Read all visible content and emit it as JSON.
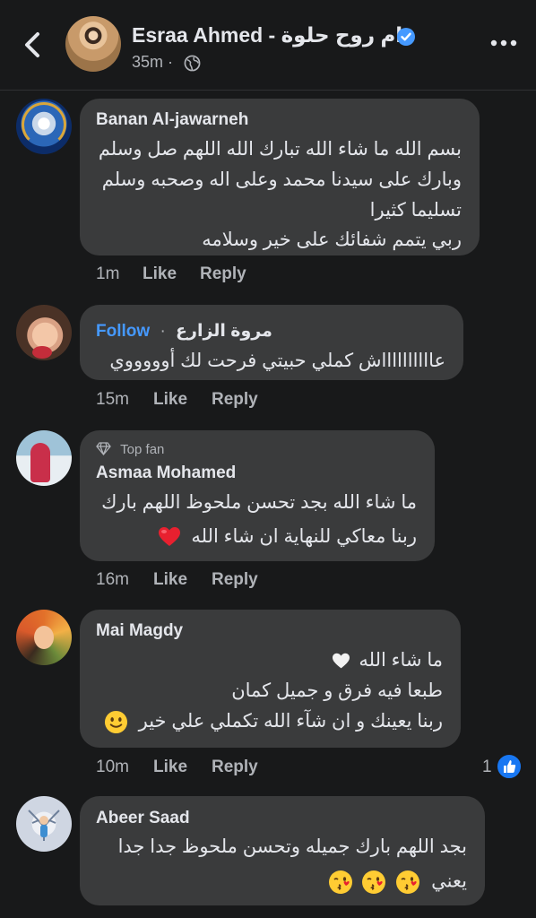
{
  "header": {
    "author": "Esraa Ahmed - ام روح حلوة",
    "time": "35m",
    "dot": "·"
  },
  "comments": [
    {
      "author": "Banan Al-jawarneh",
      "lines": [
        "بسم الله ما شاء الله تبارك الله اللهم صل وسلم",
        "وبارك على سيدنا محمد وعلى اله وصحبه وسلم",
        "تسليما كثيرا",
        "ربي يتمم شفائك على خير وسلامه"
      ],
      "time": "1m",
      "like": "Like",
      "reply": "Reply"
    },
    {
      "author": "مروة الزارع",
      "follow": "Follow",
      "dot": "·",
      "lines": [
        "عااااااااااش كملي حبيتي فرحت لك أوووووي"
      ],
      "time": "15m",
      "like": "Like",
      "reply": "Reply"
    },
    {
      "badge": "Top fan",
      "author": "Asmaa Mohamed",
      "lines": [
        "ما شاء الله بجد تحسن ملحوظ اللهم بارك",
        "ربنا معاكي للنهاية ان شاء الله"
      ],
      "time": "16m",
      "like": "Like",
      "reply": "Reply"
    },
    {
      "author": "Mai Magdy",
      "lines": [
        "ما شاء الله",
        "طبعا فيه فرق  و جميل كمان",
        "ربنا  يعينك و ان شآء الله  تكملي علي خير"
      ],
      "time": "10m",
      "like": "Like",
      "reply": "Reply",
      "reactions": "1"
    },
    {
      "author": "Abeer Saad",
      "lines": [
        "بجد اللهم بارك جميله وتحسن ملحوظ جدا جدا",
        "يعني"
      ]
    }
  ],
  "icons": {
    "back": "chevron-left-icon",
    "verified": "verified-badge-icon",
    "globe": "globe-icon",
    "more": "more-horizontal-icon",
    "top_fan": "diamond-icon",
    "heart_red": "red-heart-emoji",
    "heart_white": "white-heart-emoji",
    "smile": "slightly-smiling-face-emoji",
    "kiss": "face-blowing-kiss-emoji",
    "like_reaction": "thumbs-up-icon"
  },
  "colors": {
    "background": "#18191a",
    "bubble": "#3a3b3c",
    "text": "#e4e6eb",
    "secondary": "#b0b3b8",
    "link": "#4599ff",
    "like_blue": "#1877f2"
  }
}
